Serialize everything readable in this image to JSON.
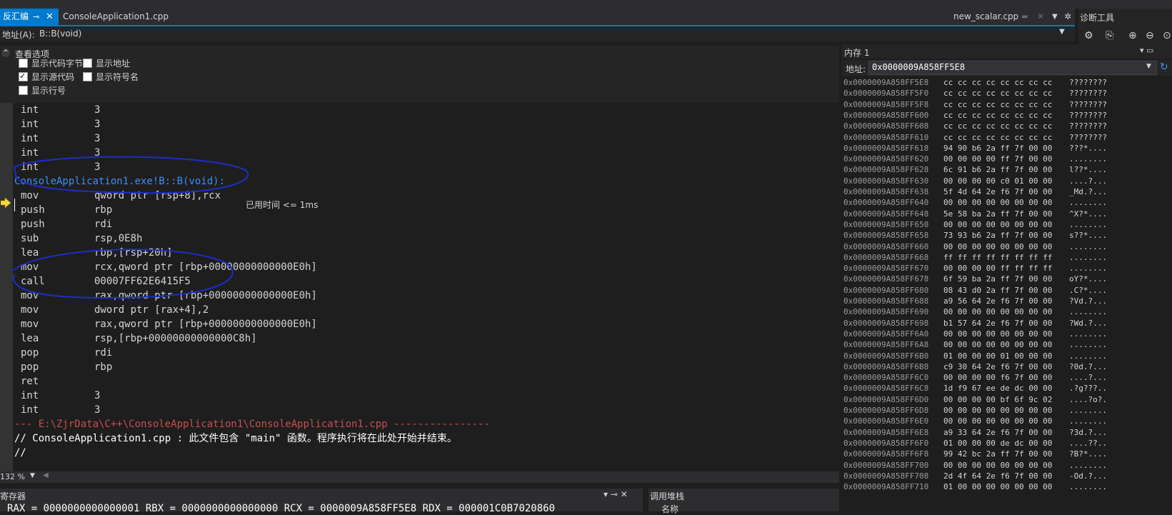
{
  "tabs": {
    "disasm": "反汇编",
    "cpp": "ConsoleApplication1.cpp",
    "scalar": "new_scalar.cpp",
    "pin": "⊸",
    "close": "✕"
  },
  "diagnostics": {
    "title": "诊断工具"
  },
  "address": {
    "label": "地址(A):",
    "value": "B::B(void)"
  },
  "view_options": {
    "title": "查看选项",
    "options": [
      {
        "label": "显示代码字节",
        "checked": false
      },
      {
        "label": "显示地址",
        "checked": false
      },
      {
        "label": "显示源代码",
        "checked": true
      },
      {
        "label": "显示符号名",
        "checked": false
      },
      {
        "label": "显示行号",
        "checked": false
      }
    ]
  },
  "code": {
    "lines": [
      {
        "kind": "asm",
        "mn": "int",
        "op": "3"
      },
      {
        "kind": "asm",
        "mn": "int",
        "op": "3"
      },
      {
        "kind": "asm",
        "mn": "int",
        "op": "3"
      },
      {
        "kind": "asm",
        "mn": "int",
        "op": "3"
      },
      {
        "kind": "asm",
        "mn": "int",
        "op": "3"
      },
      {
        "kind": "src",
        "text": "ConsoleApplication1.exe!B::B(void):"
      },
      {
        "kind": "asm",
        "mn": "mov",
        "op": "qword ptr [rsp+8],rcx"
      },
      {
        "kind": "asm",
        "mn": "push",
        "op": "rbp"
      },
      {
        "kind": "asm",
        "mn": "push",
        "op": "rdi"
      },
      {
        "kind": "asm",
        "mn": "sub",
        "op": "rsp,0E8h"
      },
      {
        "kind": "asm",
        "mn": "lea",
        "op": "rbp,[rsp+20h]"
      },
      {
        "kind": "asm",
        "mn": "mov",
        "op": "rcx,qword ptr [rbp+00000000000000E0h]"
      },
      {
        "kind": "asm",
        "mn": "call",
        "op": "00007FF62E6415F5"
      },
      {
        "kind": "asm",
        "mn": "mov",
        "op": "rax,qword ptr [rbp+00000000000000E0h]"
      },
      {
        "kind": "asm",
        "mn": "mov",
        "op": "dword ptr [rax+4],2"
      },
      {
        "kind": "asm",
        "mn": "mov",
        "op": "rax,qword ptr [rbp+00000000000000E0h]"
      },
      {
        "kind": "asm",
        "mn": "lea",
        "op": "rsp,[rbp+00000000000000C8h]"
      },
      {
        "kind": "asm",
        "mn": "pop",
        "op": "rdi"
      },
      {
        "kind": "asm",
        "mn": "pop",
        "op": "rbp"
      },
      {
        "kind": "asm",
        "mn": "ret",
        "op": ""
      },
      {
        "kind": "asm",
        "mn": "int",
        "op": "3"
      },
      {
        "kind": "asm",
        "mn": "int",
        "op": "3"
      },
      {
        "kind": "sep",
        "text": "--- E:\\ZjrData\\C++\\ConsoleApplication1\\ConsoleApplication1.cpp ----------------"
      },
      {
        "kind": "comment",
        "text": "// ConsoleApplication1.cpp : 此文件包含 \"main\" 函数。程序执行将在此处开始并结束。"
      },
      {
        "kind": "comment",
        "text": "//"
      }
    ],
    "elapsed": "已用时间 <= 1ms"
  },
  "zoom": "132 %",
  "registers": {
    "title": "寄存器",
    "line": "RAX = 0000000000000001 RBX = 0000000000000000 RCX = 0000009A858FF5E8 RDX = 000001C0B7020860"
  },
  "callstack": {
    "title": "调用堆栈",
    "column": "名称"
  },
  "memory": {
    "title": "内存 1",
    "address_label": "地址:",
    "address_value": "0x0000009A858FF5E8",
    "rows": [
      {
        "addr": "0x0000009A858FF5E8",
        "hex": "cc cc cc cc cc cc cc cc",
        "ascii": "????????"
      },
      {
        "addr": "0x0000009A858FF5F0",
        "hex": "cc cc cc cc cc cc cc cc",
        "ascii": "????????"
      },
      {
        "addr": "0x0000009A858FF5F8",
        "hex": "cc cc cc cc cc cc cc cc",
        "ascii": "????????"
      },
      {
        "addr": "0x0000009A858FF600",
        "hex": "cc cc cc cc cc cc cc cc",
        "ascii": "????????"
      },
      {
        "addr": "0x0000009A858FF608",
        "hex": "cc cc cc cc cc cc cc cc",
        "ascii": "????????"
      },
      {
        "addr": "0x0000009A858FF610",
        "hex": "cc cc cc cc cc cc cc cc",
        "ascii": "????????"
      },
      {
        "addr": "0x0000009A858FF618",
        "hex": "94 90 b6 2a ff 7f 00 00",
        "ascii": "???*...."
      },
      {
        "addr": "0x0000009A858FF620",
        "hex": "00 00 00 00 ff 7f 00 00",
        "ascii": "........"
      },
      {
        "addr": "0x0000009A858FF628",
        "hex": "6c 91 b6 2a ff 7f 00 00",
        "ascii": "l??*...."
      },
      {
        "addr": "0x0000009A858FF630",
        "hex": "00 00 00 00 c0 01 00 00",
        "ascii": "....?..."
      },
      {
        "addr": "0x0000009A858FF638",
        "hex": "5f 4d 64 2e f6 7f 00 00",
        "ascii": "_Md.?..."
      },
      {
        "addr": "0x0000009A858FF640",
        "hex": "00 00 00 00 00 00 00 00",
        "ascii": "........"
      },
      {
        "addr": "0x0000009A858FF648",
        "hex": "5e 58 ba 2a ff 7f 00 00",
        "ascii": "^X?*...."
      },
      {
        "addr": "0x0000009A858FF650",
        "hex": "00 00 00 00 00 00 00 00",
        "ascii": "........"
      },
      {
        "addr": "0x0000009A858FF658",
        "hex": "73 93 b6 2a ff 7f 00 00",
        "ascii": "s??*...."
      },
      {
        "addr": "0x0000009A858FF660",
        "hex": "00 00 00 00 00 00 00 00",
        "ascii": "........"
      },
      {
        "addr": "0x0000009A858FF668",
        "hex": "ff ff ff ff ff ff ff ff",
        "ascii": "........"
      },
      {
        "addr": "0x0000009A858FF670",
        "hex": "00 00 00 00 ff ff ff ff",
        "ascii": "........"
      },
      {
        "addr": "0x0000009A858FF678",
        "hex": "6f 59 ba 2a ff 7f 00 00",
        "ascii": "oY?*...."
      },
      {
        "addr": "0x0000009A858FF680",
        "hex": "08 43 d0 2a ff 7f 00 00",
        "ascii": ".C?*...."
      },
      {
        "addr": "0x0000009A858FF688",
        "hex": "a9 56 64 2e f6 7f 00 00",
        "ascii": "?Vd.?..."
      },
      {
        "addr": "0x0000009A858FF690",
        "hex": "00 00 00 00 00 00 00 00",
        "ascii": "........"
      },
      {
        "addr": "0x0000009A858FF698",
        "hex": "b1 57 64 2e f6 7f 00 00",
        "ascii": "?Wd.?..."
      },
      {
        "addr": "0x0000009A858FF6A0",
        "hex": "00 00 00 00 00 00 00 00",
        "ascii": "........"
      },
      {
        "addr": "0x0000009A858FF6A8",
        "hex": "00 00 00 00 00 00 00 00",
        "ascii": "........"
      },
      {
        "addr": "0x0000009A858FF6B0",
        "hex": "01 00 00 00 01 00 00 00",
        "ascii": "........"
      },
      {
        "addr": "0x0000009A858FF6B8",
        "hex": "c9 30 64 2e f6 7f 00 00",
        "ascii": "?0d.?..."
      },
      {
        "addr": "0x0000009A858FF6C0",
        "hex": "00 00 00 00 f6 7f 00 00",
        "ascii": "....?..."
      },
      {
        "addr": "0x0000009A858FF6C8",
        "hex": "1d f9 67 ee de dc 00 00",
        "ascii": ".?g???.."
      },
      {
        "addr": "0x0000009A858FF6D0",
        "hex": "00 00 00 00 bf 6f 9c 02",
        "ascii": "....?o?."
      },
      {
        "addr": "0x0000009A858FF6D8",
        "hex": "00 00 00 00 00 00 00 00",
        "ascii": "........"
      },
      {
        "addr": "0x0000009A858FF6E0",
        "hex": "00 00 00 00 00 00 00 00",
        "ascii": "........"
      },
      {
        "addr": "0x0000009A858FF6E8",
        "hex": "a9 33 64 2e f6 7f 00 00",
        "ascii": "?3d.?..."
      },
      {
        "addr": "0x0000009A858FF6F0",
        "hex": "01 00 00 00 de dc 00 00",
        "ascii": "....??.."
      },
      {
        "addr": "0x0000009A858FF6F8",
        "hex": "99 42 bc 2a ff 7f 00 00",
        "ascii": "?B?*...."
      },
      {
        "addr": "0x0000009A858FF700",
        "hex": "00 00 00 00 00 00 00 00",
        "ascii": "........"
      },
      {
        "addr": "0x0000009A858FF708",
        "hex": "2d 4f 64 2e f6 7f 00 00",
        "ascii": "-Od.?..."
      },
      {
        "addr": "0x0000009A858FF710",
        "hex": "01 00 00 00 00 00 00 00",
        "ascii": "........"
      }
    ]
  }
}
